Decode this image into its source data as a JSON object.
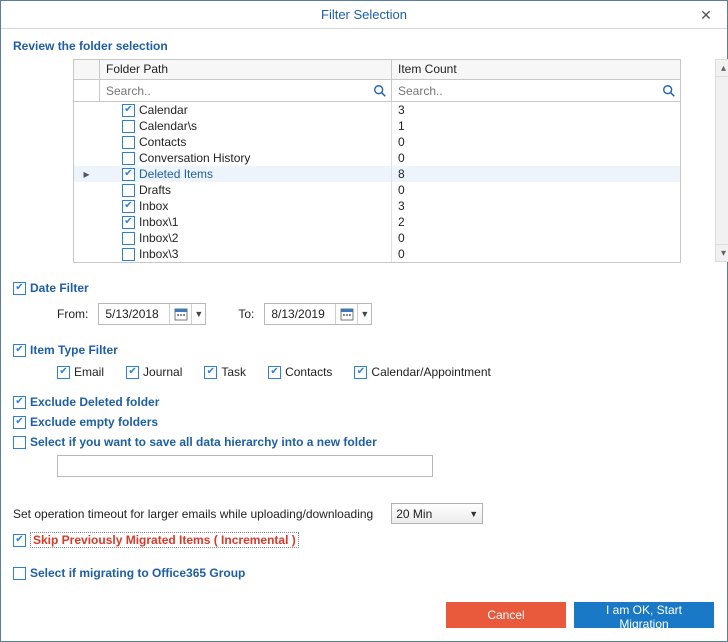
{
  "window": {
    "title": "Filter Selection"
  },
  "section": {
    "review": "Review the folder selection"
  },
  "grid": {
    "headers": {
      "path": "Folder Path",
      "count": "Item Count"
    },
    "search_placeholder": "Search..",
    "rows": [
      {
        "indent": 0,
        "checked": true,
        "expander": "",
        "label": "Calendar",
        "count": "3",
        "selected": false
      },
      {
        "indent": 0,
        "checked": false,
        "expander": "",
        "label": "Calendar\\s",
        "count": "1",
        "selected": false
      },
      {
        "indent": 0,
        "checked": false,
        "expander": "",
        "label": "Contacts",
        "count": "0",
        "selected": false
      },
      {
        "indent": 0,
        "checked": false,
        "expander": "",
        "label": "Conversation History",
        "count": "0",
        "selected": false
      },
      {
        "indent": 0,
        "checked": true,
        "expander": "▸",
        "label": "Deleted Items",
        "count": "8",
        "selected": true
      },
      {
        "indent": 0,
        "checked": false,
        "expander": "",
        "label": "Drafts",
        "count": "0",
        "selected": false
      },
      {
        "indent": 0,
        "checked": true,
        "expander": "",
        "label": "Inbox",
        "count": "3",
        "selected": false
      },
      {
        "indent": 0,
        "checked": true,
        "expander": "",
        "label": "Inbox\\1",
        "count": "2",
        "selected": false
      },
      {
        "indent": 0,
        "checked": false,
        "expander": "",
        "label": "Inbox\\2",
        "count": "0",
        "selected": false
      },
      {
        "indent": 0,
        "checked": false,
        "expander": "",
        "label": "Inbox\\3",
        "count": "0",
        "selected": false
      }
    ]
  },
  "date_filter": {
    "label": "Date Filter",
    "checked": true,
    "from_label": "From:",
    "to_label": "To:",
    "from": "5/13/2018",
    "to": "8/13/2019"
  },
  "item_type": {
    "label": "Item Type Filter",
    "checked": true,
    "types": {
      "email": {
        "label": "Email",
        "checked": true
      },
      "journal": {
        "label": "Journal",
        "checked": true
      },
      "task": {
        "label": "Task",
        "checked": true
      },
      "contacts": {
        "label": "Contacts",
        "checked": true
      },
      "calendar": {
        "label": "Calendar/Appointment",
        "checked": true
      }
    }
  },
  "exclude_deleted": {
    "label": "Exclude Deleted folder",
    "checked": true
  },
  "exclude_empty": {
    "label": "Exclude empty folders",
    "checked": true
  },
  "save_hierarchy": {
    "label": "Select if you want to save all data hierarchy into a new folder",
    "checked": false,
    "value": ""
  },
  "timeout": {
    "label": "Set operation timeout for larger emails while uploading/downloading",
    "value": "20 Min"
  },
  "skip_prev": {
    "label": "Skip Previously Migrated Items ( Incremental )",
    "checked": true
  },
  "o365group": {
    "label": "Select if migrating to Office365 Group",
    "checked": false
  },
  "buttons": {
    "cancel": "Cancel",
    "start": "I am OK, Start Migration"
  }
}
